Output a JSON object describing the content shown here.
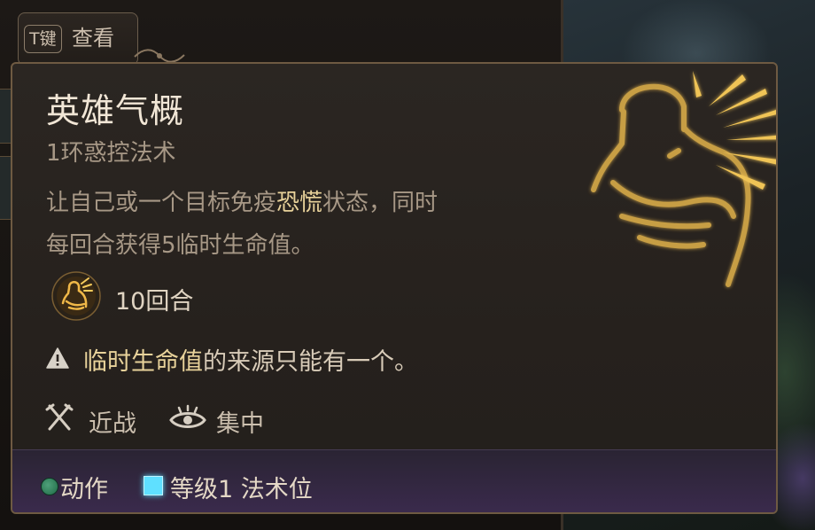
{
  "hint": {
    "key": "T键",
    "label": "查看"
  },
  "spell": {
    "name": "英雄气概",
    "level_school": "1环惑控法术",
    "description": {
      "line1_pre": "让自己或一个目标免疫",
      "line1_keyword": "恐慌",
      "line1_post": "状态，同时",
      "line2": "每回合获得5临时生命值。"
    },
    "duration": "10回合",
    "warning": {
      "keyword": "临时生命值",
      "rest": "的来源只能有一个。"
    },
    "tags": [
      {
        "icon": "crossed-swords-icon",
        "label": "近战"
      },
      {
        "icon": "concentration-eye-icon",
        "label": "集中"
      }
    ],
    "cost": {
      "action_icon": "green-action-dot-icon",
      "action_label": "动作",
      "slot_icon": "cyan-spell-slot-icon",
      "slot_label": "等级1 法术位"
    }
  },
  "colors": {
    "title": "#f1e6d6",
    "body": "#a79886",
    "keyword": "#e8d29a",
    "border": "#6e5a42",
    "art": "#e3b44c",
    "action": "#2f8a5e",
    "slot": "#5fe0ff",
    "footer": "#3a2a4c"
  }
}
